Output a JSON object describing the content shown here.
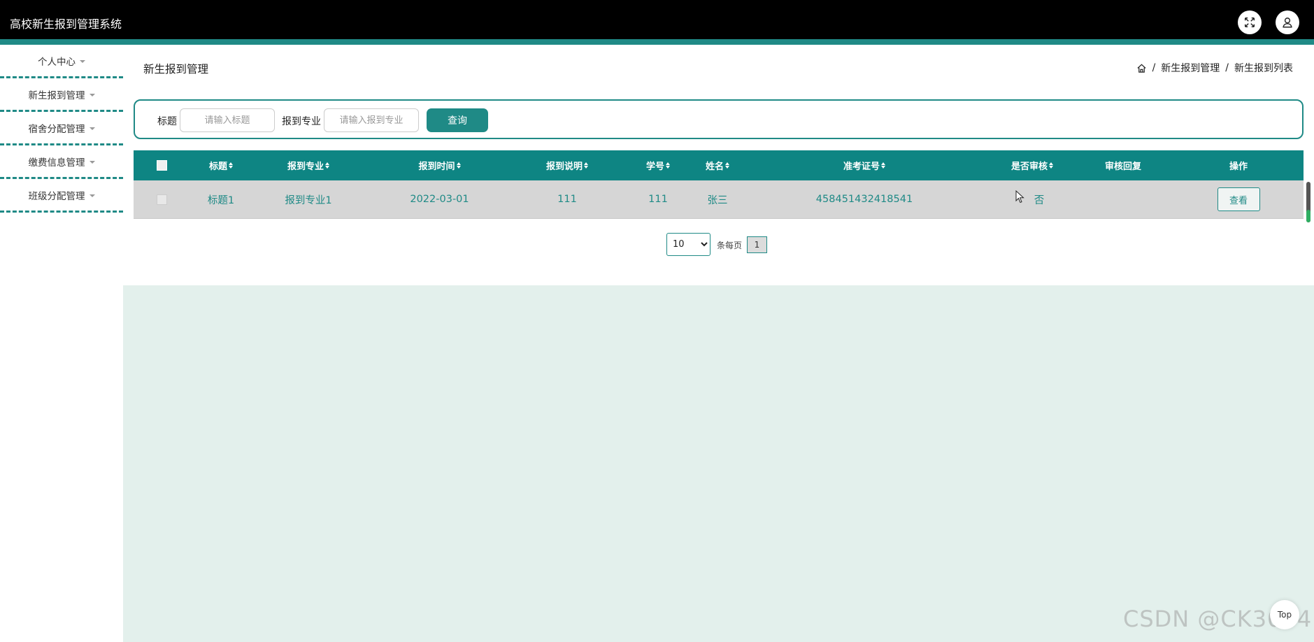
{
  "app": {
    "title": "高校新生报到管理系统"
  },
  "header_icons": {
    "fullscreen": "fullscreen-icon",
    "user": "user-icon"
  },
  "colors": {
    "accent": "#1f8a86",
    "header_bg": "#000000",
    "content_bg": "#e3f0ec",
    "row_bg": "#d6d6d6"
  },
  "sidebar": {
    "items": [
      {
        "label": "个人中心"
      },
      {
        "label": "新生报到管理"
      },
      {
        "label": "宿舍分配管理"
      },
      {
        "label": "缴费信息管理"
      },
      {
        "label": "班级分配管理"
      }
    ]
  },
  "page": {
    "title": "新生报到管理"
  },
  "breadcrumb": {
    "items": [
      "新生报到管理",
      "新生报到列表"
    ],
    "separator": "/"
  },
  "search": {
    "title_label": "标题",
    "title_placeholder": "请输入标题",
    "major_label": "报到专业",
    "major_placeholder": "请输入报到专业",
    "button_label": "查询"
  },
  "table": {
    "headers": [
      "标题",
      "报到专业",
      "报到时间",
      "报到说明",
      "学号",
      "姓名",
      "准考证号",
      "是否审核",
      "审核回复",
      "操作"
    ],
    "rows": [
      {
        "title": "标题1",
        "major": "报到专业1",
        "time": "2022-03-01",
        "description": "111",
        "student_id": "111",
        "name": "张三",
        "exam_no": "458451432418541",
        "reviewed": "否",
        "reply": "",
        "action": "查看"
      }
    ]
  },
  "pagination": {
    "page_size": "10",
    "page_size_options": [
      "10"
    ],
    "per_page_label": "条每页",
    "current_page": "1"
  },
  "back_to_top": {
    "label": "Top"
  },
  "watermark": "CSDN @CK3034"
}
